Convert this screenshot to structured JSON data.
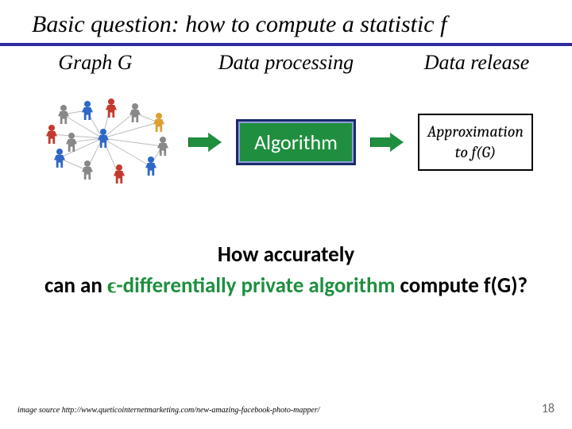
{
  "title": "Basic question: how to compute a statistic f",
  "columns": {
    "left": "Graph G",
    "mid": "Data processing",
    "right": "Data release"
  },
  "algorithm_label": "Algorithm",
  "approx": {
    "line1": "Approximation",
    "line2": "to f(G)"
  },
  "question": {
    "line1": "How accurately",
    "prefix": "can an ",
    "epsilon": "ϵ",
    "green_part": "-differentially private algorithm",
    "suffix": " compute f(G)?"
  },
  "credit": "image source http://www.queticointernetmarketing.com/new-amazing-facebook-photo-mapper/",
  "pagenum": "18"
}
